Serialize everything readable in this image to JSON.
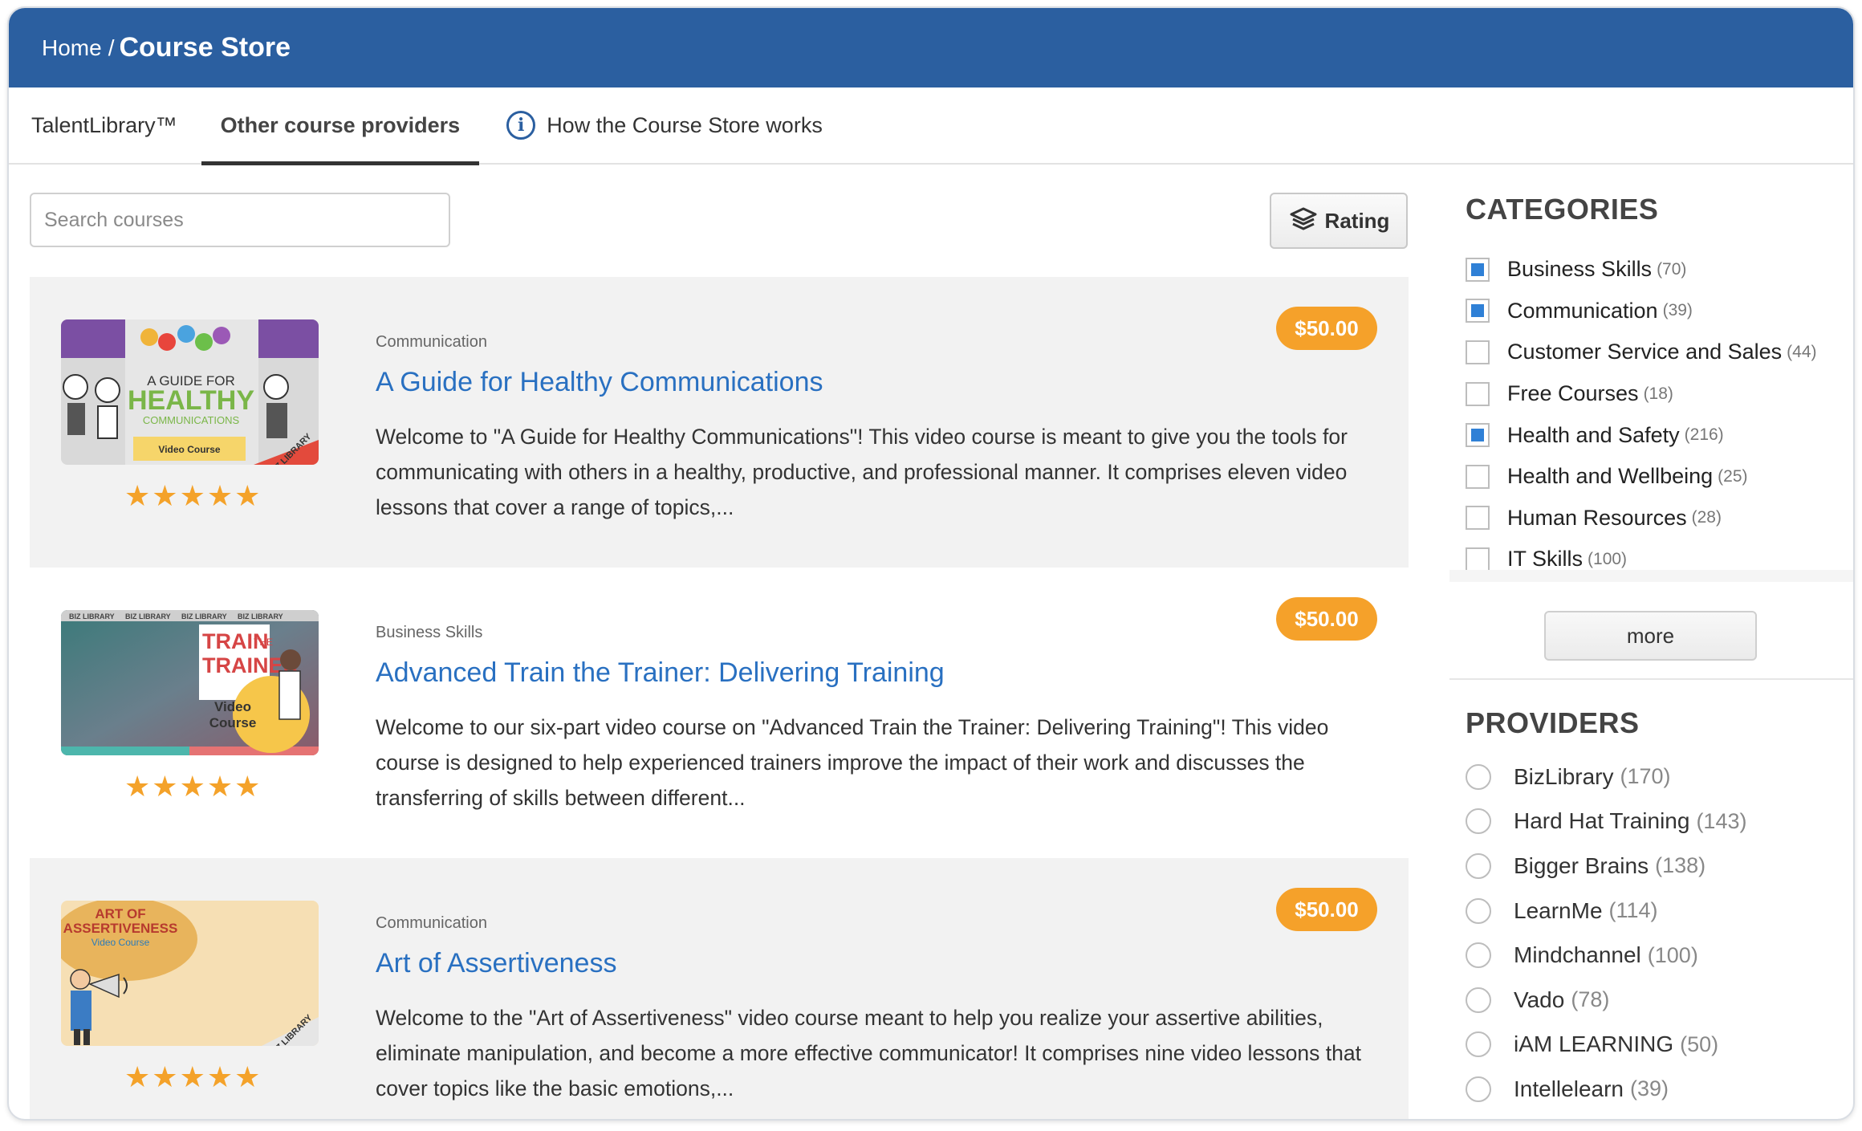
{
  "header": {
    "breadcrumb_home": "Home",
    "breadcrumb_sep": "/",
    "breadcrumb_current": "Course Store"
  },
  "tabs": [
    {
      "label": "TalentLibrary™"
    },
    {
      "label": "Other course providers",
      "active": true
    },
    {
      "label": "How the Course Store works",
      "icon": "info-icon"
    }
  ],
  "search": {
    "placeholder": "Search courses",
    "value": ""
  },
  "sort": {
    "label": "Rating",
    "icon": "layers-icon"
  },
  "courses": [
    {
      "category": "Communication",
      "title": "A Guide for Healthy Communications",
      "description": "Welcome to \"A Guide for Healthy Communications\"! This video course is meant to give you the tools for communicating with others in a healthy, productive, and professional manner. It comprises eleven video lessons that cover a range of topics,...",
      "price": "$50.00",
      "rating": 5,
      "thumb": {
        "line1": "A GUIDE FOR",
        "line2": "HEALTHY",
        "line3": "COMMUNICATIONS",
        "badge": "Video Course",
        "brand": "BIZ LIBRARY"
      }
    },
    {
      "category": "Business Skills",
      "title": "Advanced Train the Trainer: Delivering Training",
      "description": "Welcome to our six-part video course on \"Advanced Train the Trainer: Delivering Training\"! This video course is designed to help experienced trainers improve the impact of their work and discusses the transferring of skills between different...",
      "price": "$50.00",
      "rating": 5,
      "thumb": {
        "line1": "TRAIN",
        "line1b": "THE",
        "line2": "TRAINER",
        "badge1": "Video",
        "badge2": "Course",
        "brand": "BIZ LIBRARY"
      }
    },
    {
      "category": "Communication",
      "title": "Art of Assertiveness",
      "description": "Welcome to the \"Art of Assertiveness\" video course meant to help you realize your assertive abilities, eliminate manipulation, and become a more effective communicator! It comprises nine video lessons that cover topics like the basic emotions,...",
      "price": "$50.00",
      "rating": 5,
      "thumb": {
        "line1": "ART OF",
        "line2": "ASSERTIVENESS",
        "badge": "Video Course",
        "brand": "BIZ LIBRARY"
      }
    }
  ],
  "categories": {
    "heading": "CATEGORIES",
    "items": [
      {
        "label": "Business Skills",
        "count": "(70)",
        "checked": true
      },
      {
        "label": "Communication",
        "count": "(39)",
        "checked": true
      },
      {
        "label": "Customer Service and Sales",
        "count": "(44)",
        "checked": false
      },
      {
        "label": "Free Courses",
        "count": "(18)",
        "checked": false
      },
      {
        "label": "Health and Safety",
        "count": "(216)",
        "checked": true
      },
      {
        "label": "Health and Wellbeing",
        "count": "(25)",
        "checked": false
      },
      {
        "label": "Human Resources",
        "count": "(28)",
        "checked": false
      },
      {
        "label": "IT Skills",
        "count": "(100)",
        "checked": false
      }
    ],
    "more_label": "more"
  },
  "providers": {
    "heading": "PROVIDERS",
    "items": [
      {
        "label": "BizLibrary",
        "count": "(170)"
      },
      {
        "label": "Hard Hat Training",
        "count": "(143)"
      },
      {
        "label": "Bigger Brains",
        "count": "(138)"
      },
      {
        "label": "LearnMe",
        "count": "(114)"
      },
      {
        "label": "Mindchannel",
        "count": "(100)"
      },
      {
        "label": "Vado",
        "count": "(78)"
      },
      {
        "label": "iAM LEARNING",
        "count": "(50)"
      },
      {
        "label": "Intellelearn",
        "count": "(39)"
      }
    ]
  },
  "colors": {
    "header_bg": "#2b5fa0",
    "link": "#2970c1",
    "price_badge": "#f5a12a",
    "star": "#f4a22a",
    "checkbox_on": "#2f80d6"
  }
}
